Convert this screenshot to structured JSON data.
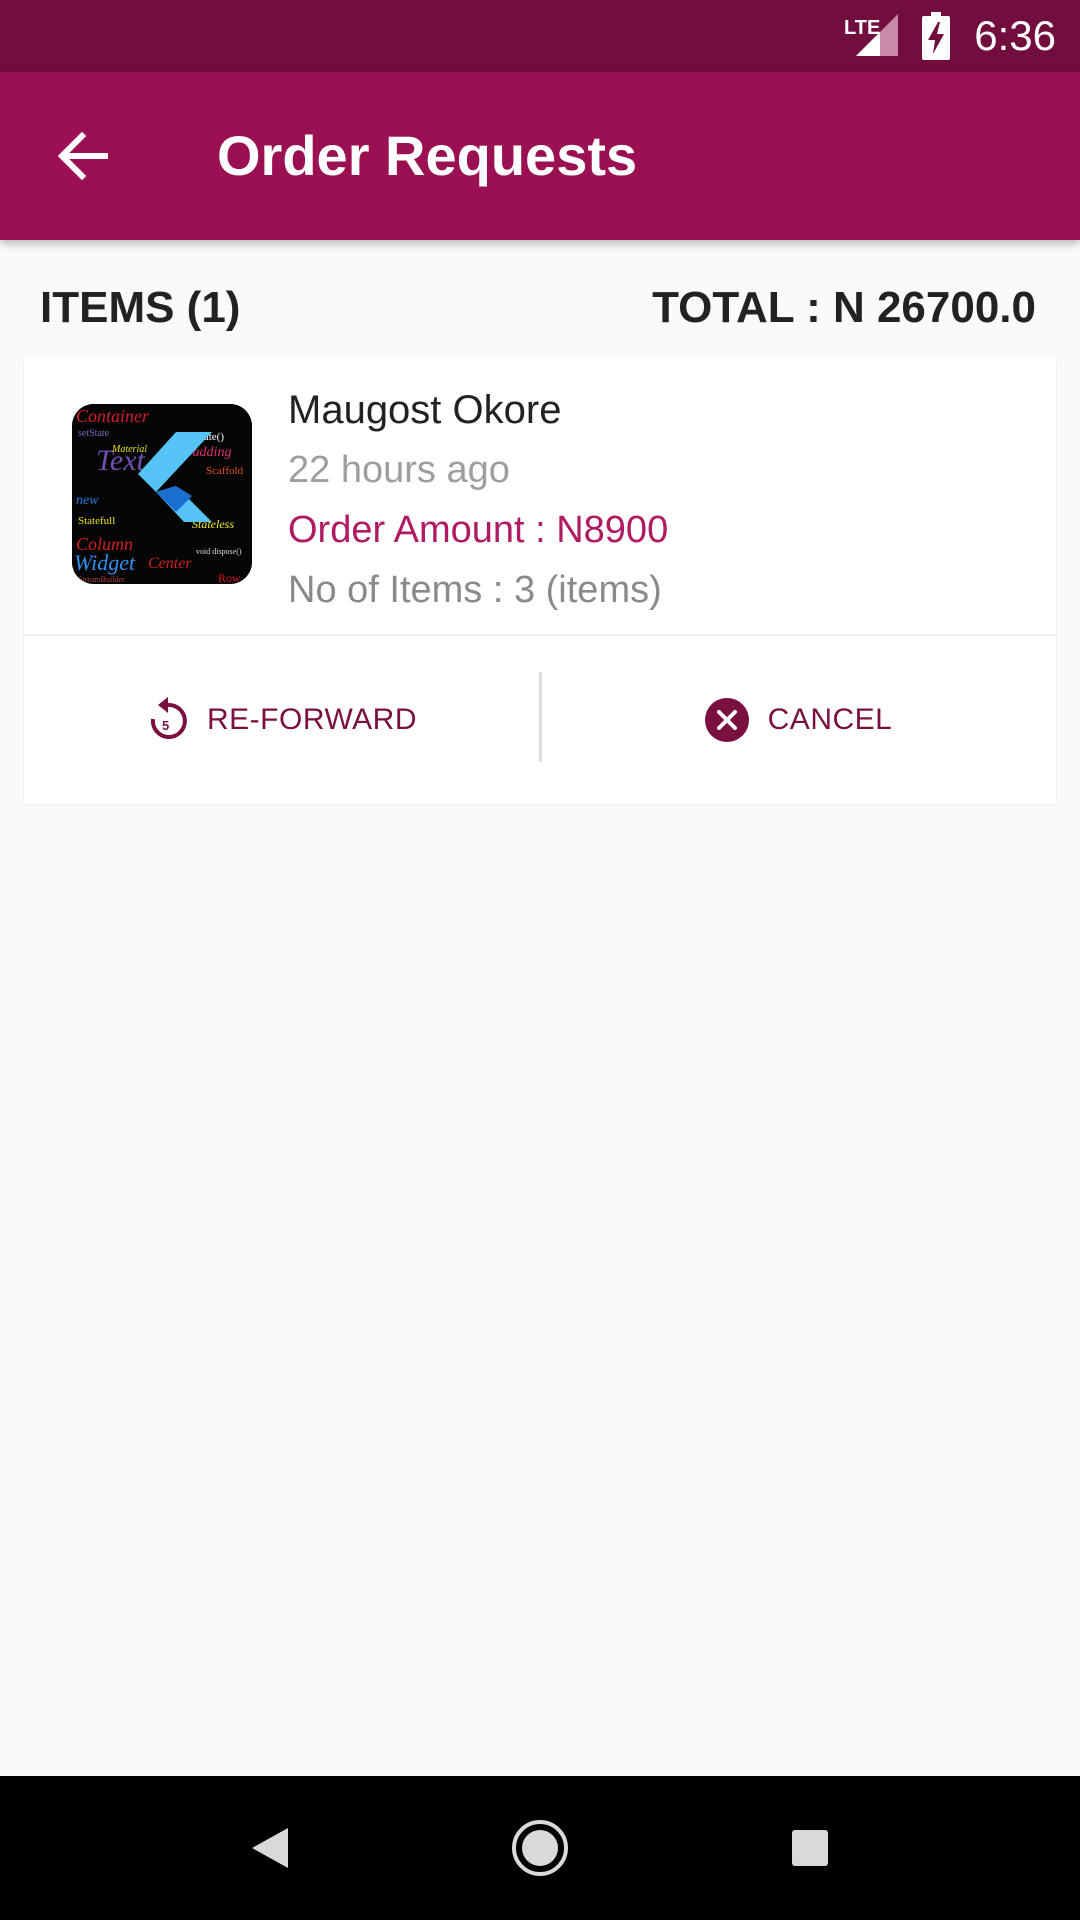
{
  "status_bar": {
    "network": "LTE",
    "time": "6:36"
  },
  "app_bar": {
    "title": "Order Requests"
  },
  "summary": {
    "items_label": "ITEMS (1)",
    "total_label": "TOTAL : N 26700.0"
  },
  "orders": [
    {
      "name": "Maugost Okore",
      "time_ago": "22 hours ago",
      "amount": "Order Amount : N8900",
      "items": "No of Items : 3 (items)",
      "actions": {
        "reforward_label": "RE-FORWARD",
        "cancel_label": "CANCEL"
      }
    }
  ],
  "colors": {
    "status_bar": "#720e3e",
    "app_bar": "#9a1053",
    "accent_text": "#b01a63",
    "action_text": "#7a1040"
  }
}
